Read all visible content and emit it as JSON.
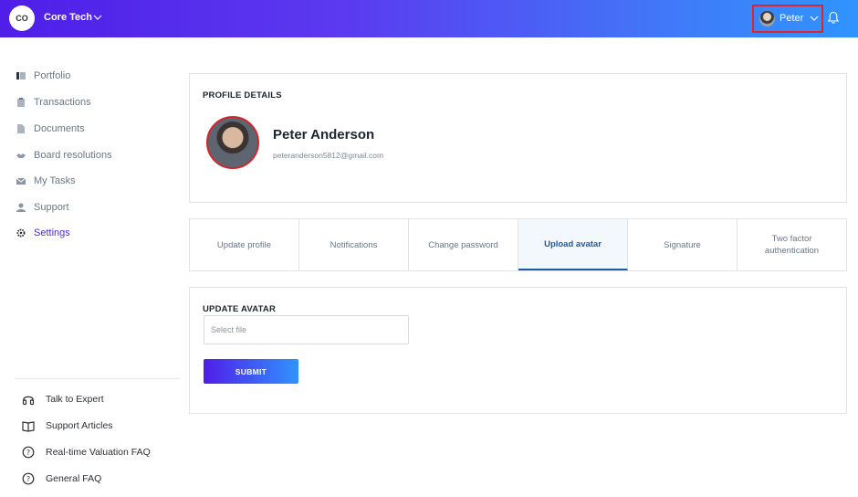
{
  "topbar": {
    "org_initials": "CO",
    "org_name": "Core Tech",
    "user_name": "Peter"
  },
  "sidebar": {
    "items": [
      {
        "label": "Portfolio",
        "icon": "portfolio-icon"
      },
      {
        "label": "Transactions",
        "icon": "clipboard-icon"
      },
      {
        "label": "Documents",
        "icon": "document-icon"
      },
      {
        "label": "Board resolutions",
        "icon": "handshake-icon"
      },
      {
        "label": "My Tasks",
        "icon": "tasks-icon"
      },
      {
        "label": "Support",
        "icon": "support-icon"
      },
      {
        "label": "Settings",
        "icon": "gear-icon",
        "active": true
      }
    ],
    "help_items": [
      {
        "label": "Talk to Expert",
        "icon": "headphones-icon"
      },
      {
        "label": "Support Articles",
        "icon": "book-icon"
      },
      {
        "label": "Real-time Valuation FAQ",
        "icon": "question-icon"
      },
      {
        "label": "General FAQ",
        "icon": "question-icon"
      }
    ]
  },
  "profile": {
    "title": "PROFILE DETAILS",
    "name": "Peter Anderson",
    "email": "peteranderson5812@gmail.com"
  },
  "tabs": [
    {
      "label": "Update profile"
    },
    {
      "label": "Notifications"
    },
    {
      "label": "Change password"
    },
    {
      "label": "Upload avatar",
      "active": true
    },
    {
      "label": "Signature"
    },
    {
      "label": "Two factor authentication"
    }
  ],
  "upload": {
    "title": "UPDATE AVATAR",
    "placeholder": "Select file",
    "submit_label": "SUBMIT"
  },
  "colors": {
    "accent": "#4a2de0",
    "tab_active": "#1f5aa6",
    "highlight_border": "#e0242c"
  }
}
